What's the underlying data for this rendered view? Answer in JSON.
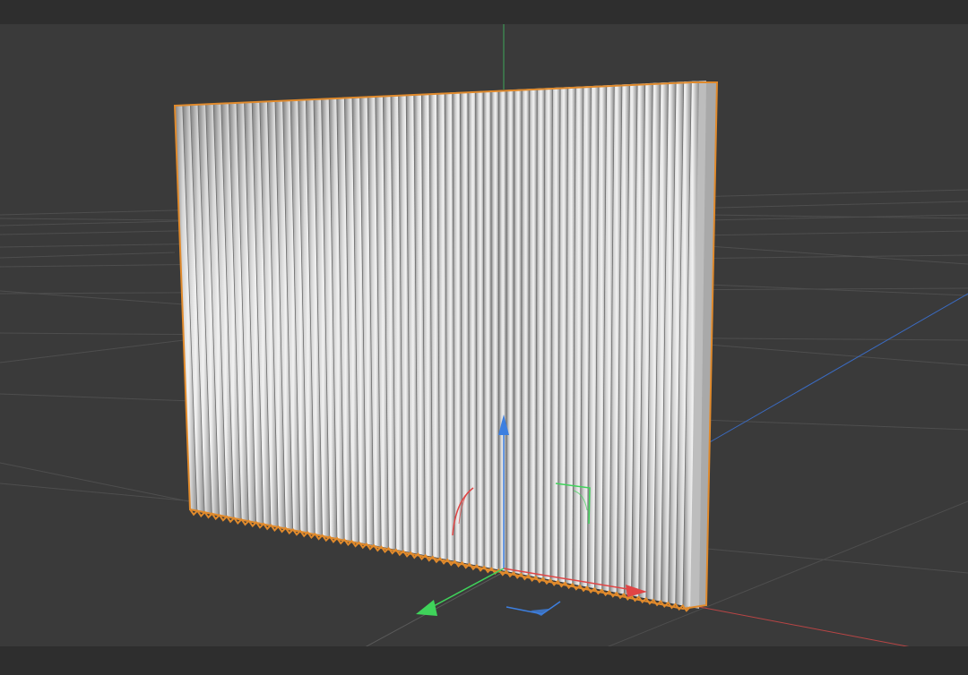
{
  "viewport": {
    "object_name": "corrugated-panel",
    "selection_color": "#e08a2c",
    "background_color": "#3a3a3a",
    "grid_color": "#4d4d4d",
    "panel_color_light": "#c9c9c9",
    "panel_color_dark": "#8c8c8c",
    "rib_count": 68,
    "axis_colors": {
      "x": "#e04545",
      "y": "#3fd35a",
      "z": "#3d7fe0"
    }
  }
}
